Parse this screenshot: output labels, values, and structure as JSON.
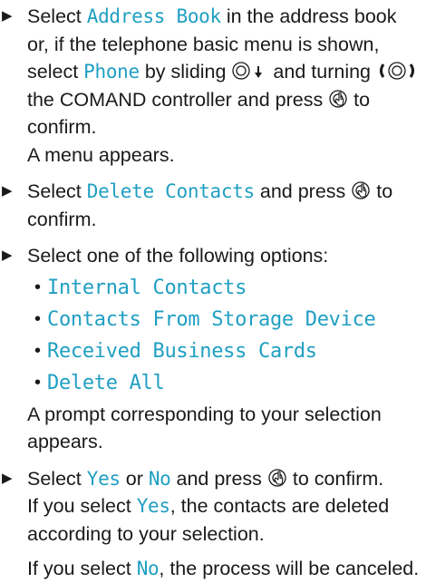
{
  "steps": [
    {
      "parts": [
        {
          "t": "Select "
        },
        {
          "ui": "Address Book"
        },
        {
          "t": " in the address book or, if the telephone basic menu is shown, select "
        },
        {
          "ui": "Phone"
        },
        {
          "t": " by sliding "
        },
        {
          "icon": "slide-down-icon"
        },
        {
          "t": " and turning "
        },
        {
          "icon": "turn-icon"
        },
        {
          "t": " the COMAND controller and press "
        },
        {
          "icon": "press-icon"
        },
        {
          "t": " to confirm."
        }
      ],
      "after": [
        "A menu appears."
      ]
    },
    {
      "parts": [
        {
          "t": "Select "
        },
        {
          "ui": "Delete Contacts"
        },
        {
          "t": " and press "
        },
        {
          "icon": "press-icon"
        },
        {
          "t": " to confirm."
        }
      ]
    },
    {
      "parts": [
        {
          "t": "Select one of the following options:"
        }
      ],
      "options": [
        "Internal Contacts",
        "Contacts From Storage Device",
        "Received Business Cards",
        "Delete All"
      ],
      "after": [
        "A prompt corresponding to your selection appears."
      ]
    },
    {
      "parts": [
        {
          "t": "Select "
        },
        {
          "ui": "Yes"
        },
        {
          "t": " or "
        },
        {
          "ui": "No"
        },
        {
          "t": " and press "
        },
        {
          "icon": "press-icon"
        },
        {
          "t": " to confirm."
        }
      ],
      "after_parts": [
        [
          {
            "t": "If you select "
          },
          {
            "ui": "Yes"
          },
          {
            "t": ", the contacts are deleted according to your selection."
          }
        ],
        [
          {
            "t": "If you select "
          },
          {
            "ui": "No"
          },
          {
            "t": ", the process will be can­celed."
          }
        ]
      ]
    }
  ],
  "colors": {
    "ui_text": "#1f9fc2",
    "body_text": "#1a1a1a"
  }
}
